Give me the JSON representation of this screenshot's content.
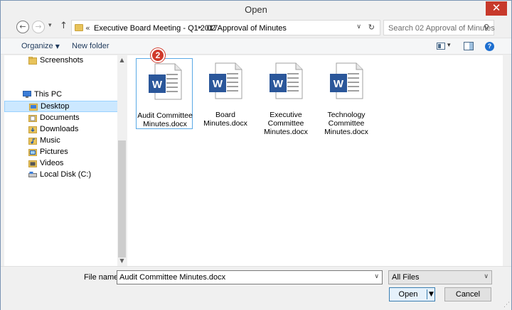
{
  "window": {
    "title": "Open",
    "close_glyph": "✕"
  },
  "nav": {
    "back_glyph": "←",
    "forward_glyph": "→",
    "recent_glyph": "▾",
    "up_glyph": "↑"
  },
  "address": {
    "overflow": "«",
    "crumbs": [
      "Executive Board Meeting - Q1 2017",
      "02 Approval of Minutes"
    ],
    "separator": "▸",
    "dropdown_glyph": "∨",
    "refresh_glyph": "↻"
  },
  "search": {
    "placeholder": "Search 02 Approval of Minutes",
    "icon_glyph": "⚲"
  },
  "toolbar": {
    "organize_label": "Organize",
    "organize_caret": "▼",
    "new_folder_label": "New folder",
    "view_caret": "▾",
    "help_glyph": "?"
  },
  "sidebar": {
    "items": [
      {
        "label": "Screenshots",
        "icon": "folder-icon"
      },
      {
        "label": "This PC",
        "icon": "computer-icon"
      },
      {
        "label": "Desktop",
        "icon": "desktop-folder-icon",
        "selected": true
      },
      {
        "label": "Documents",
        "icon": "documents-folder-icon"
      },
      {
        "label": "Downloads",
        "icon": "downloads-folder-icon"
      },
      {
        "label": "Music",
        "icon": "music-folder-icon"
      },
      {
        "label": "Pictures",
        "icon": "pictures-folder-icon"
      },
      {
        "label": "Videos",
        "icon": "videos-folder-icon"
      },
      {
        "label": "Local Disk (C:)",
        "icon": "drive-icon"
      }
    ],
    "scroll_up": "▲",
    "scroll_down": "▼"
  },
  "files": [
    {
      "name": "Audit Committee Minutes.docx",
      "selected": true
    },
    {
      "name": "Board Minutes.docx"
    },
    {
      "name": "Executive Committee Minutes.docx"
    },
    {
      "name": "Technology Committee Minutes.docx"
    }
  ],
  "step_badge": "2",
  "bottom": {
    "file_name_label": "File name:",
    "file_name_value": "Audit Committee Minutes.docx",
    "file_type_value": "All Files",
    "dropdown_glyph": "∨",
    "open_label": "Open",
    "open_arrow": "▼",
    "cancel_label": "Cancel",
    "grip_glyph": "⋰"
  },
  "colors": {
    "word_blue": "#2b579a",
    "badge_red": "#d0392b",
    "selection": "#cce8ff",
    "close_red": "#c7392b"
  }
}
